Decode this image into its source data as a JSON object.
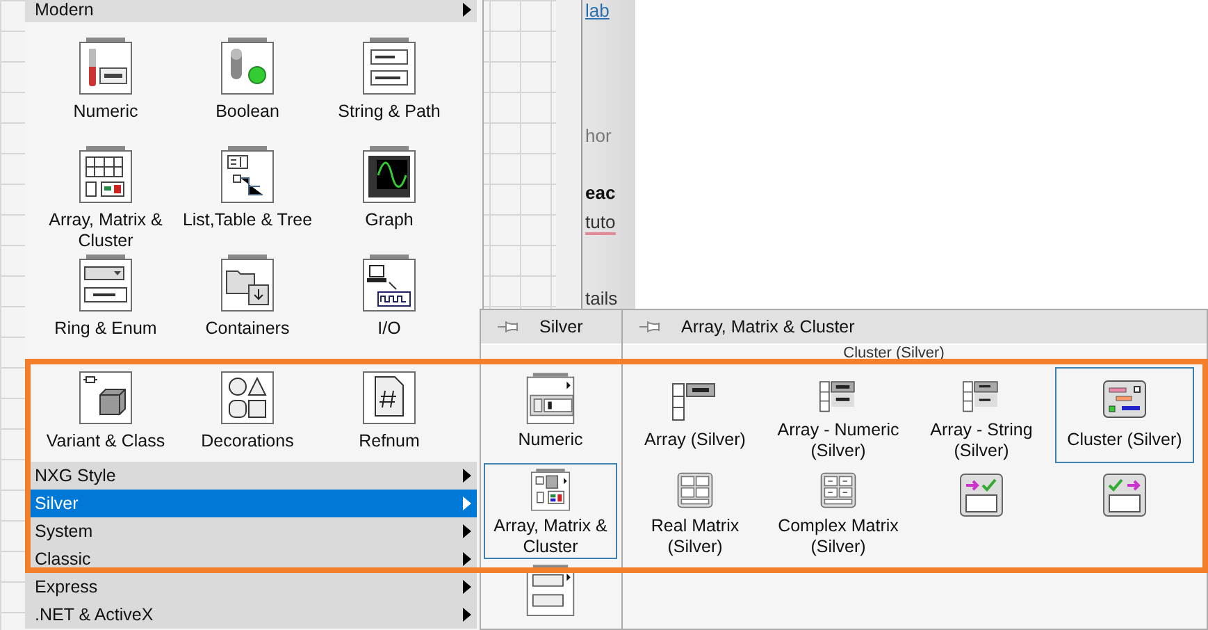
{
  "background_page": {
    "texts": [
      {
        "kind": "link",
        "text": "lab"
      },
      {
        "kind": "muted",
        "text": "hor"
      },
      {
        "kind": "bold",
        "text": "eac"
      },
      {
        "kind": "underlined",
        "text": "tuto"
      },
      {
        "kind": "plain",
        "text": "tails"
      }
    ]
  },
  "controls_palette": {
    "header": "Modern",
    "items": [
      {
        "kind": "thermometer",
        "label": "Numeric"
      },
      {
        "kind": "toggle",
        "label": "Boolean"
      },
      {
        "kind": "text-fields",
        "label": "String & Path"
      },
      {
        "kind": "array-grid",
        "label": "Array, Matrix & Cluster"
      },
      {
        "kind": "tree-list",
        "label": "List,Table & Tree"
      },
      {
        "kind": "graph",
        "label": "Graph"
      },
      {
        "kind": "ring",
        "label": "Ring & Enum"
      },
      {
        "kind": "folder",
        "label": "Containers"
      },
      {
        "kind": "computer",
        "label": "I/O"
      },
      {
        "kind": "cube",
        "label": "Variant & Class"
      },
      {
        "kind": "shapes",
        "label": "Decorations"
      },
      {
        "kind": "document",
        "label": "Refnum"
      }
    ],
    "categories": [
      {
        "label": "NXG Style",
        "selected": false
      },
      {
        "label": "Silver",
        "selected": true
      },
      {
        "label": "System",
        "selected": false
      },
      {
        "label": "Classic",
        "selected": false
      },
      {
        "label": "Express",
        "selected": false
      },
      {
        "label": ".NET & ActiveX",
        "selected": false
      }
    ]
  },
  "silver_palette": {
    "title": "Silver",
    "items": [
      {
        "kind": "numeric-control",
        "label": "Numeric",
        "selected": false
      },
      {
        "kind": "silver-array",
        "label": "Array, Matrix & Cluster",
        "selected": true
      },
      {
        "kind": "silver-ring",
        "selected": false
      }
    ]
  },
  "array_palette": {
    "title": "Array, Matrix & Cluster",
    "caption": "Cluster (Silver)",
    "items": [
      {
        "kind": "array",
        "label": "Array (Silver)",
        "selected": false
      },
      {
        "kind": "numeric-array",
        "label": "Array - Numeric (Silver)",
        "selected": false
      },
      {
        "kind": "string-array",
        "label": "Array - String (Silver)",
        "selected": false
      },
      {
        "kind": "cluster",
        "label": "Cluster (Silver)",
        "selected": true
      },
      {
        "kind": "matrix",
        "label": "Real Matrix (Silver)",
        "selected": false
      },
      {
        "kind": "complex-matrix",
        "label": "Complex Matrix (Silver)",
        "selected": false
      },
      {
        "kind": "arrow-check",
        "selected": false
      },
      {
        "kind": "check-arrow",
        "selected": false
      }
    ]
  }
}
